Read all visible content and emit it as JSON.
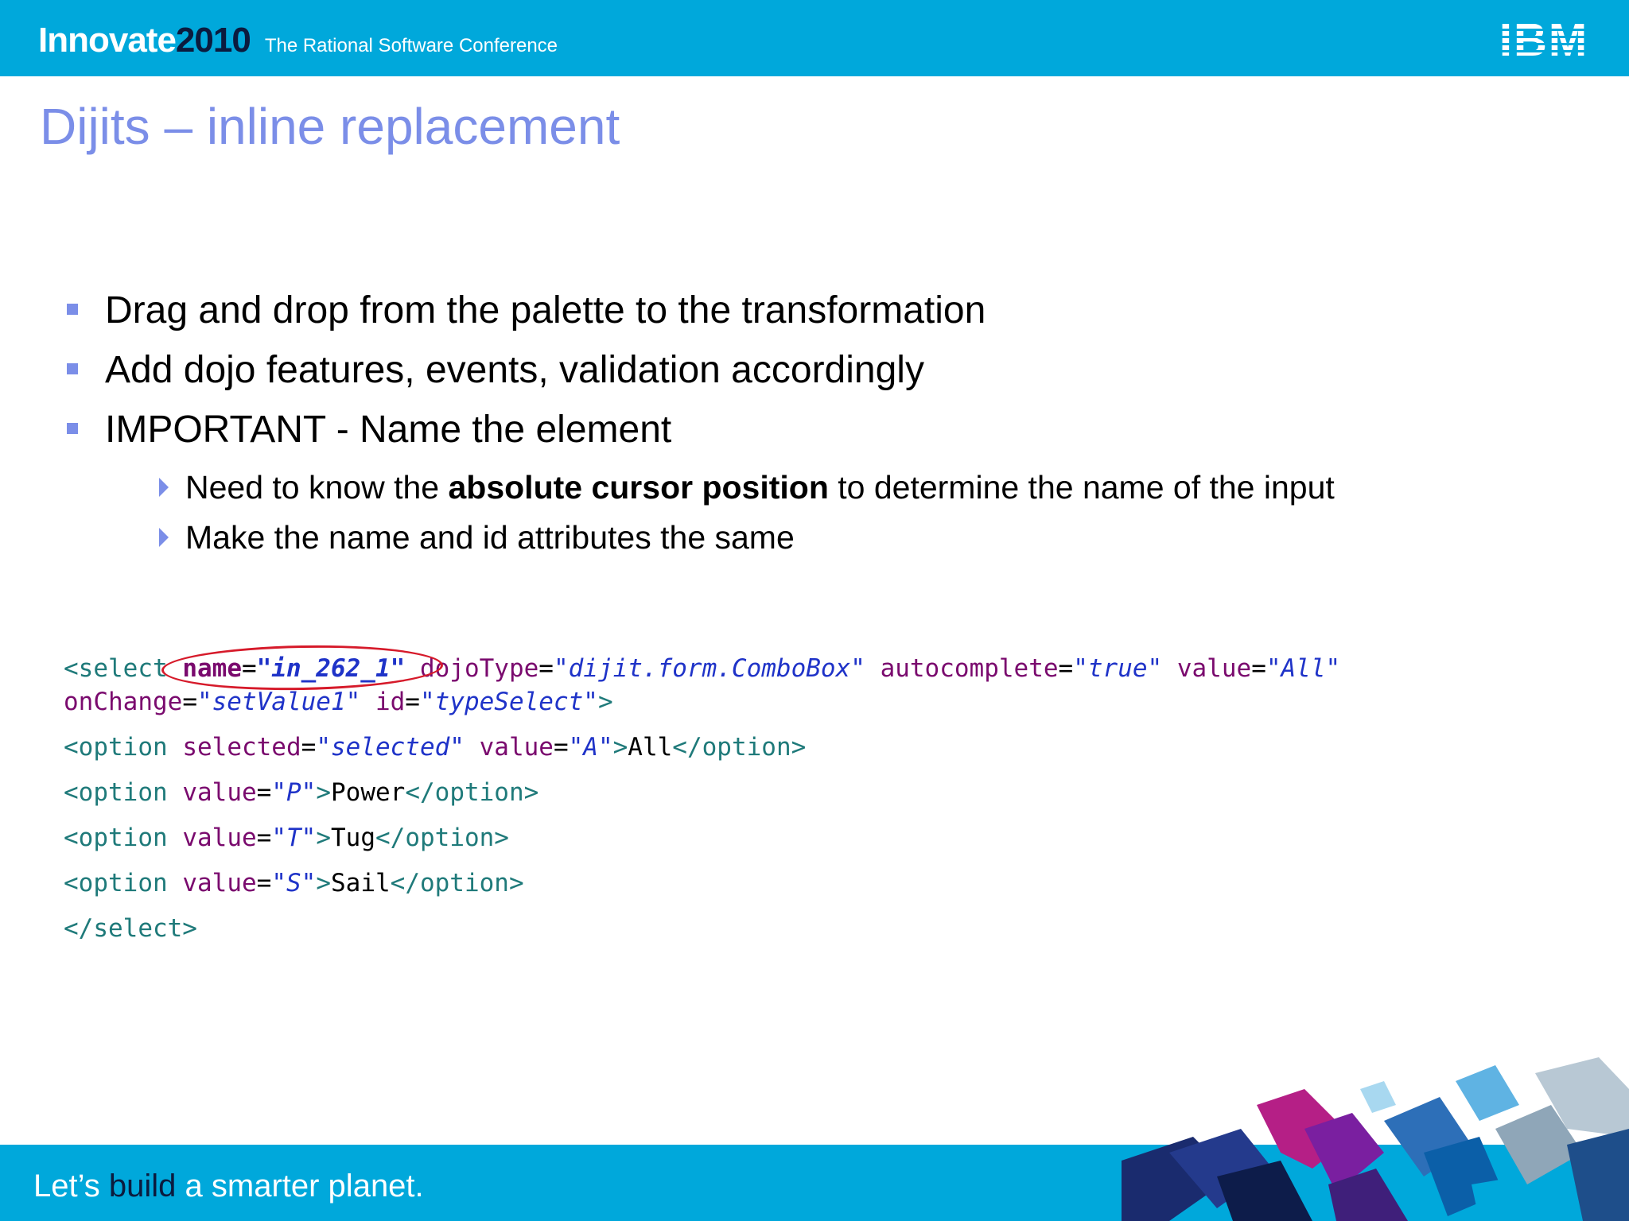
{
  "header": {
    "brand_innovate": "Innovate",
    "brand_year": "2010",
    "tagline": "The Rational Software Conference",
    "logo": "IBM",
    "logo_icon": "ibm-striped-logo"
  },
  "slide": {
    "title": "Dijits – inline replacement"
  },
  "bullets": [
    "Drag and drop from the palette to the transformation",
    "Add dojo features, events, validation accordingly",
    "IMPORTANT - Name the element"
  ],
  "subbullets": [
    {
      "before": "Need to know the ",
      "bold": "absolute cursor position",
      "after": " to determine the name of the input"
    },
    {
      "text": "Make the name and id attributes the same"
    }
  ],
  "code": {
    "select_open": "<select",
    "name_attr": "name",
    "name_val": "\"in_262_1\"",
    "dojotype_attr": "dojoType",
    "dojotype_val": "\"dijit.form.ComboBox\"",
    "autocomplete_attr": "autocomplete",
    "autocomplete_val": "\"true\"",
    "value_attr": "value",
    "select_value_val": "\"All\"",
    "onchange_attr": "onChange",
    "onchange_val": "\"setValue1\"",
    "id_attr": "id",
    "id_val": "\"typeSelect\"",
    "gt": ">",
    "option_open": "<option",
    "option_close": "</option>",
    "selected_attr": "selected",
    "selected_val": "\"selected\"",
    "options": [
      {
        "value": "\"A\"",
        "label": "All"
      },
      {
        "value": "\"P\"",
        "label": "Power"
      },
      {
        "value": "\"T\"",
        "label": "Tug"
      },
      {
        "value": "\"S\"",
        "label": "Sail"
      }
    ],
    "select_close": "</select>",
    "highlight_color": "#d61a2a"
  },
  "footer": {
    "tagline_pre": "Let’s ",
    "tagline_strong": "build",
    "tagline_post": " a smarter planet."
  },
  "colors": {
    "brand_blue": "#00a8db",
    "title_color": "#7b8ee8",
    "navy": "#0b1b3e"
  }
}
